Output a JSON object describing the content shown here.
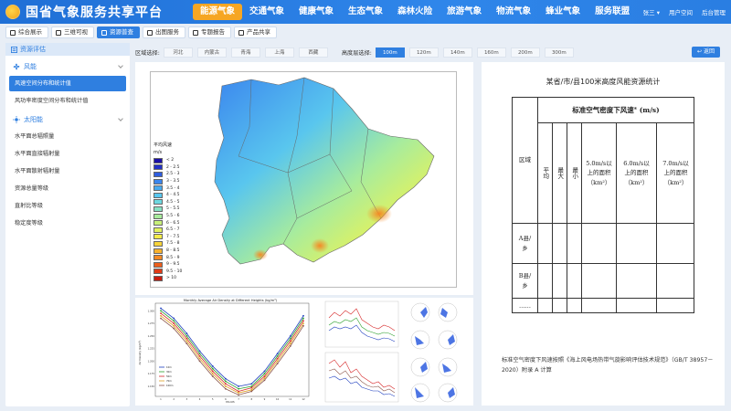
{
  "app": {
    "title": "国省气象服务共享平台"
  },
  "nav": {
    "items": [
      "能源气象",
      "交通气象",
      "健康气象",
      "生态气象",
      "森林火险",
      "旅游气象",
      "物流气象",
      "蜂业气象",
      "服务联盟"
    ],
    "active_index": 0
  },
  "header_right": {
    "user": "张三 ▾",
    "space": "用户空间",
    "admin": "后台管理"
  },
  "subtabs": [
    "综合展示",
    "三维可视",
    "资源普查",
    "出图服务",
    "专题报告",
    "产品共享"
  ],
  "subtab_active": 2,
  "sidebar": {
    "title": "资源评估",
    "wind": {
      "label": "风能",
      "items": [
        "风速空间分布和统计值",
        "风功率密度空间分布和统计值"
      ]
    },
    "solar": {
      "label": "太阳能",
      "items": [
        "水平面总辐照量",
        "水平面直接辐射量",
        "水平面散射辐射量",
        "资源总量等级",
        "直射比等级",
        "稳定度等级"
      ]
    }
  },
  "filters": {
    "region_label": "区域选择:",
    "regions": [
      "河北",
      "内蒙古",
      "青海",
      "上海",
      "西藏"
    ],
    "height_label": "高度层选择:",
    "heights": [
      "100m",
      "120m",
      "140m",
      "160m",
      "200m",
      "300m"
    ],
    "height_selected": 0,
    "back": "返回"
  },
  "map": {
    "legend_title": "平均风速",
    "legend_unit": "m/s",
    "legend_labels": [
      "< 2",
      "2 - 2.5",
      "2.5 - 3",
      "3 - 3.5",
      "3.5 - 4",
      "4 - 4.5",
      "4.5 - 5",
      "5 - 5.5",
      "5.5 - 6",
      "6 - 6.5",
      "6.5 - 7",
      "7 - 7.5",
      "7.5 - 8",
      "8 - 8.5",
      "8.5 - 9",
      "9 - 9.5",
      "9.5 - 10",
      "> 10"
    ],
    "legend_colors": [
      "#1a10a8",
      "#2232c8",
      "#2f5ee0",
      "#3b86ee",
      "#48aaf0",
      "#59c6ee",
      "#6ed8e0",
      "#88e2c4",
      "#a8ec9c",
      "#c8f07a",
      "#e2f25e",
      "#f4ec48",
      "#f8d43a",
      "#f8b22e",
      "#f48a24",
      "#ec5e1c",
      "#e03a16",
      "#c81c10"
    ]
  },
  "density_chart": {
    "title": "Monthly Average Air Density at Different Heights (kg/m³)",
    "xlabel": "Month",
    "ylabel": "Air Density (kg/m³)",
    "x": [
      1,
      2,
      3,
      4,
      5,
      6,
      7,
      8,
      9,
      10,
      11,
      12
    ],
    "series": [
      {
        "name": "10m",
        "color": "#1f3fbf",
        "values": [
          1.305,
          1.285,
          1.255,
          1.22,
          1.19,
          1.165,
          1.15,
          1.155,
          1.18,
          1.215,
          1.25,
          1.29
        ]
      },
      {
        "name": "30m",
        "color": "#2ca02c",
        "values": [
          1.3,
          1.28,
          1.25,
          1.215,
          1.185,
          1.16,
          1.145,
          1.15,
          1.175,
          1.21,
          1.245,
          1.285
        ]
      },
      {
        "name": "50m",
        "color": "#d62728",
        "values": [
          1.295,
          1.275,
          1.245,
          1.21,
          1.18,
          1.155,
          1.14,
          1.147,
          1.17,
          1.205,
          1.24,
          1.28
        ]
      },
      {
        "name": "70m",
        "color": "#e0a020",
        "values": [
          1.29,
          1.27,
          1.24,
          1.205,
          1.175,
          1.15,
          1.137,
          1.143,
          1.166,
          1.2,
          1.235,
          1.275
        ]
      },
      {
        "name": "100m",
        "color": "#8c564b",
        "values": [
          1.285,
          1.265,
          1.235,
          1.2,
          1.17,
          1.145,
          1.133,
          1.14,
          1.162,
          1.195,
          1.23,
          1.27
        ]
      }
    ],
    "yticks": [
      "1.300",
      "1.275",
      "1.250",
      "1.225",
      "1.200",
      "1.175",
      "1.150"
    ]
  },
  "table": {
    "title": "某省/市/县100米高度风能资源统计",
    "header_group": "标准空气密度下风速",
    "header_group_mark": "*",
    "header_group_unit": "(m/s)",
    "region": "区域",
    "avg": "平均",
    "max": "最大",
    "min": "最小",
    "col5": "5.0m/s以上的面积（km²）",
    "col6": "6.0m/s以上的面积（km²）",
    "col7": "7.0m/s以上的面积（km²）",
    "row_a": "A县/乡",
    "row_b": "B县/乡",
    "row_more": "……"
  },
  "note": "标准空气密度下风速按照《海上风电场热带气旋影响评估技术规范》（GB/T 38957－2020）附录 A 计算"
}
